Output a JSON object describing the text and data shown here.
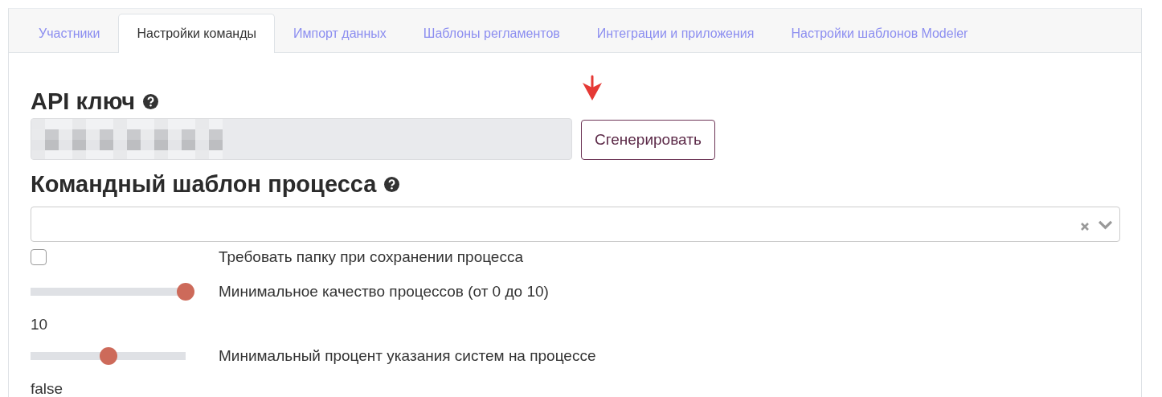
{
  "tabs": [
    {
      "label": "Участники",
      "selected": false
    },
    {
      "label": "Настройки команды",
      "selected": true
    },
    {
      "label": "Импорт данных",
      "selected": false
    },
    {
      "label": "Шаблоны регламентов",
      "selected": false
    },
    {
      "label": "Интеграции и приложения",
      "selected": false
    },
    {
      "label": "Настройки шаблонов Modeler",
      "selected": false
    }
  ],
  "api_key": {
    "heading": "API ключ",
    "value_redacted": true,
    "button": "Сгенерировать",
    "pointer_arrow": true
  },
  "template": {
    "heading": "Командный шаблон процесса",
    "clearable": true
  },
  "settings": [
    {
      "kind": "checkbox",
      "checked": false,
      "label": "Требовать папку при сохранении процесса"
    },
    {
      "kind": "slider",
      "level": 1.0,
      "label": "Минимальное качество процессов (от 0 до 10)",
      "reading": "10"
    },
    {
      "kind": "slider",
      "level": 0.5,
      "label": "Минимальный процент указания систем на процессе",
      "reading": "false"
    }
  ]
}
